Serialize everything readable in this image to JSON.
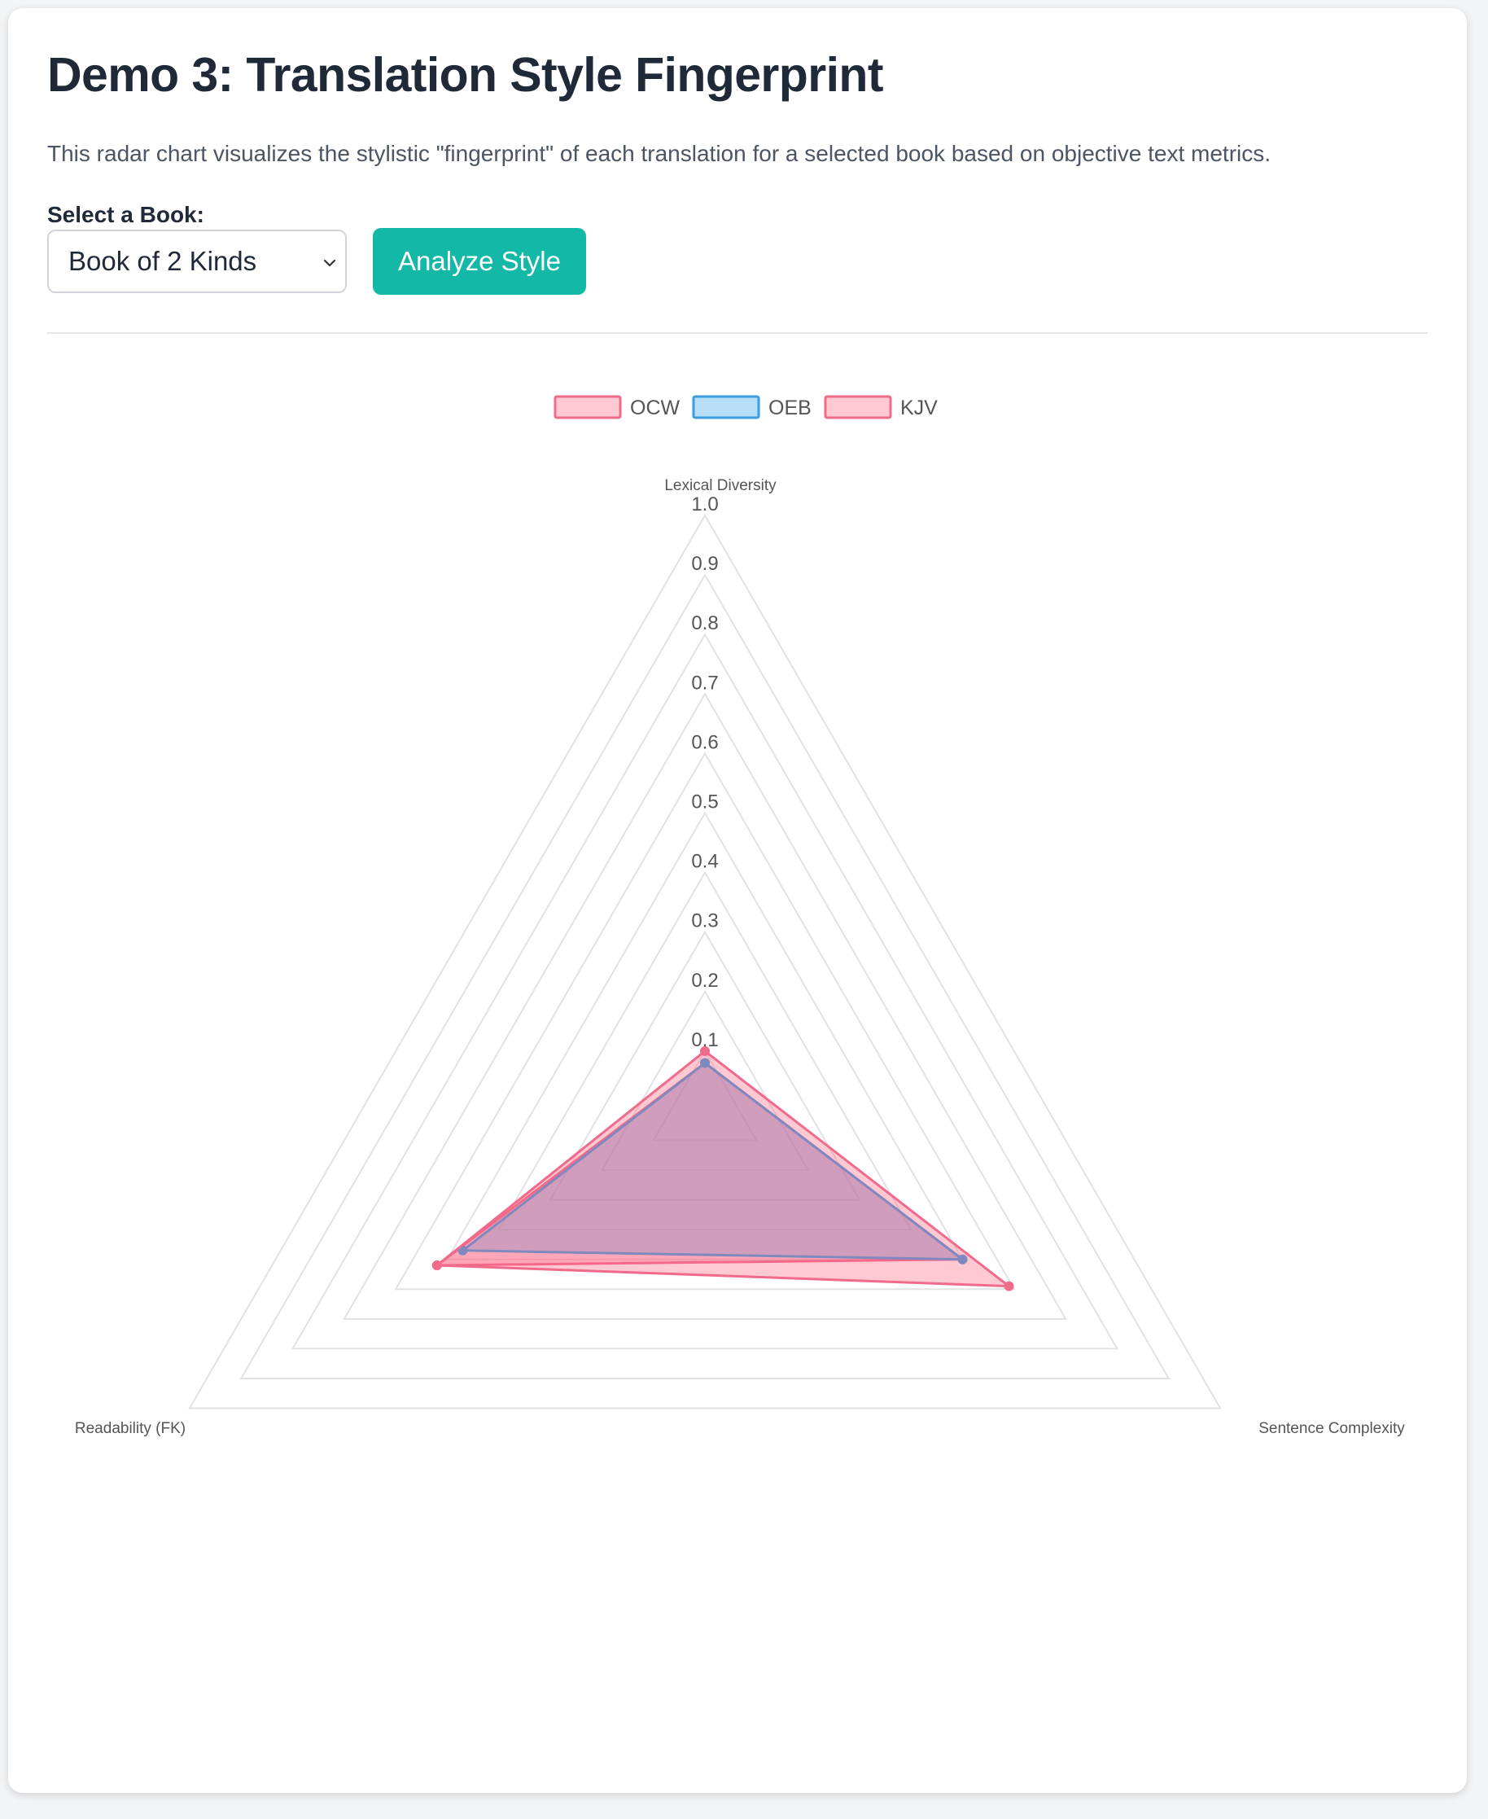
{
  "page": {
    "title": "Demo 3: Translation Style Fingerprint",
    "description": "This radar chart visualizes the stylistic \"fingerprint\" of each translation for a selected book based on objective text metrics."
  },
  "controls": {
    "select_label": "Select a Book:",
    "selected_book": "Book of 2 Kinds",
    "analyze_button": "Analyze Style",
    "chevron_icon": "chevron-down-icon"
  },
  "colors": {
    "accent": "#14b8a6",
    "pink_border": "#f06a8c",
    "pink_fill": "rgba(255, 99, 132, 0.35)",
    "blue_border": "#3b9ddd",
    "blue_fill": "rgba(54, 162, 235, 0.35)"
  },
  "chart_data": {
    "type": "radar",
    "axes": [
      "Lexical Diversity",
      "Sentence Complexity",
      "Readability (FK)"
    ],
    "rlim": [
      0,
      1.0
    ],
    "ticks": [
      "0.1",
      "0.2",
      "0.3",
      "0.4",
      "0.5",
      "0.6",
      "0.7",
      "0.8",
      "0.9",
      "1.0"
    ],
    "grid": true,
    "legend_position": "top",
    "series": [
      {
        "name": "OCW",
        "values": [
          0.08,
          0.5,
          0.52
        ],
        "border": "#f06a8c",
        "fill": "rgba(255, 99, 132, 0.35)"
      },
      {
        "name": "OEB",
        "values": [
          0.08,
          0.5,
          0.47
        ],
        "border": "#3b9ddd",
        "fill": "rgba(54, 162, 235, 0.35)"
      },
      {
        "name": "KJV",
        "values": [
          0.1,
          0.59,
          0.52
        ],
        "border": "#f06a8c",
        "fill": "rgba(255, 99, 132, 0.35)"
      }
    ]
  }
}
